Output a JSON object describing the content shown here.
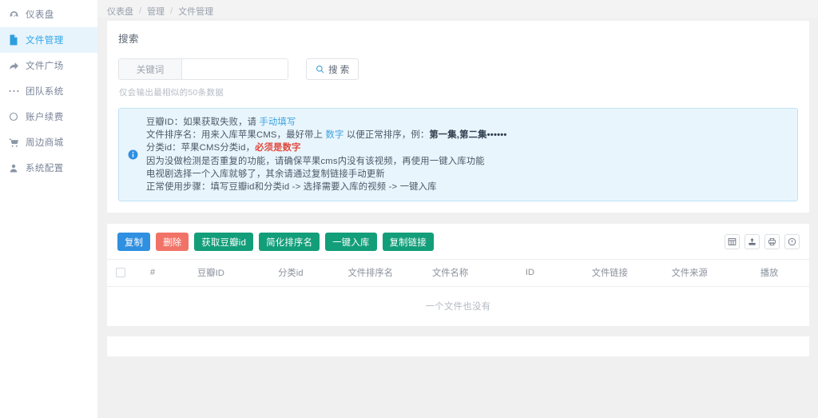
{
  "sidebar": {
    "items": [
      {
        "label": "仪表盘",
        "icon": "dashboard-icon",
        "active": false
      },
      {
        "label": "文件管理",
        "icon": "file-icon",
        "active": true
      },
      {
        "label": "文件广场",
        "icon": "share-icon",
        "active": false
      },
      {
        "label": "团队系统",
        "icon": "dots-icon",
        "active": false
      },
      {
        "label": "账户续费",
        "icon": "circle-icon",
        "active": false
      },
      {
        "label": "周边商城",
        "icon": "cart-icon",
        "active": false
      },
      {
        "label": "系统配置",
        "icon": "user-icon",
        "active": false
      }
    ]
  },
  "breadcrumb": {
    "items": [
      "仪表盘",
      "管理",
      "文件管理"
    ],
    "separator": "/"
  },
  "search": {
    "card_title": "搜索",
    "addon_label": "关键词",
    "input_value": "",
    "input_placeholder": "",
    "button_label": "搜 索",
    "hint": "仅会输出最相似的50条数据"
  },
  "alert": {
    "icon": "info-circle-icon",
    "lines": [
      [
        {
          "t": "豆瓣ID：如果获取失败，请 ",
          "s": "normal"
        },
        {
          "t": "手动填写",
          "s": "link"
        }
      ],
      [
        {
          "t": "文件排序名：用来入库苹果CMS，最好带上 ",
          "s": "normal"
        },
        {
          "t": "数字",
          "s": "link"
        },
        {
          "t": " 以便正常排序，例：",
          "s": "normal"
        },
        {
          "t": "第一集,第二集••••••",
          "s": "bold"
        }
      ],
      [
        {
          "t": "分类id：苹果CMS分类id，",
          "s": "normal"
        },
        {
          "t": "必须是数字",
          "s": "red"
        }
      ],
      [
        {
          "t": "因为没做检测是否重复的功能，请确保苹果cms内没有该视频，再使用一键入库功能",
          "s": "normal"
        }
      ],
      [
        {
          "t": "电视剧选择一个入库就够了，其余请通过复制链接手动更新",
          "s": "normal"
        }
      ],
      [
        {
          "t": "正常使用步骤：填写豆瓣id和分类id -> 选择需要入库的视频 -> 一键入库",
          "s": "normal"
        }
      ]
    ]
  },
  "toolbar": {
    "buttons": [
      {
        "label": "复制",
        "style": "primary"
      },
      {
        "label": "删除",
        "style": "danger"
      },
      {
        "label": "获取豆瓣id",
        "style": "teal"
      },
      {
        "label": "简化排序名",
        "style": "teal"
      },
      {
        "label": "一键入库",
        "style": "teal"
      },
      {
        "label": "复制链接",
        "style": "teal"
      }
    ],
    "icon_buttons": [
      {
        "name": "columns-icon"
      },
      {
        "name": "export-icon"
      },
      {
        "name": "print-icon"
      },
      {
        "name": "info-icon"
      }
    ]
  },
  "table": {
    "columns": [
      "#",
      "豆瓣ID",
      "分类id",
      "文件排序名",
      "文件名称",
      "ID",
      "文件链接",
      "文件来源",
      "播放"
    ],
    "rows": [],
    "empty_text": "一个文件也没有"
  },
  "colors": {
    "accent_blue": "#2f8fe0",
    "teal": "#139e7a",
    "danger": "#f17367",
    "alert_bg": "#e9f5fd",
    "sidebar_active_bg": "#e8f4fc",
    "page_bg": "#f0f0f0"
  }
}
